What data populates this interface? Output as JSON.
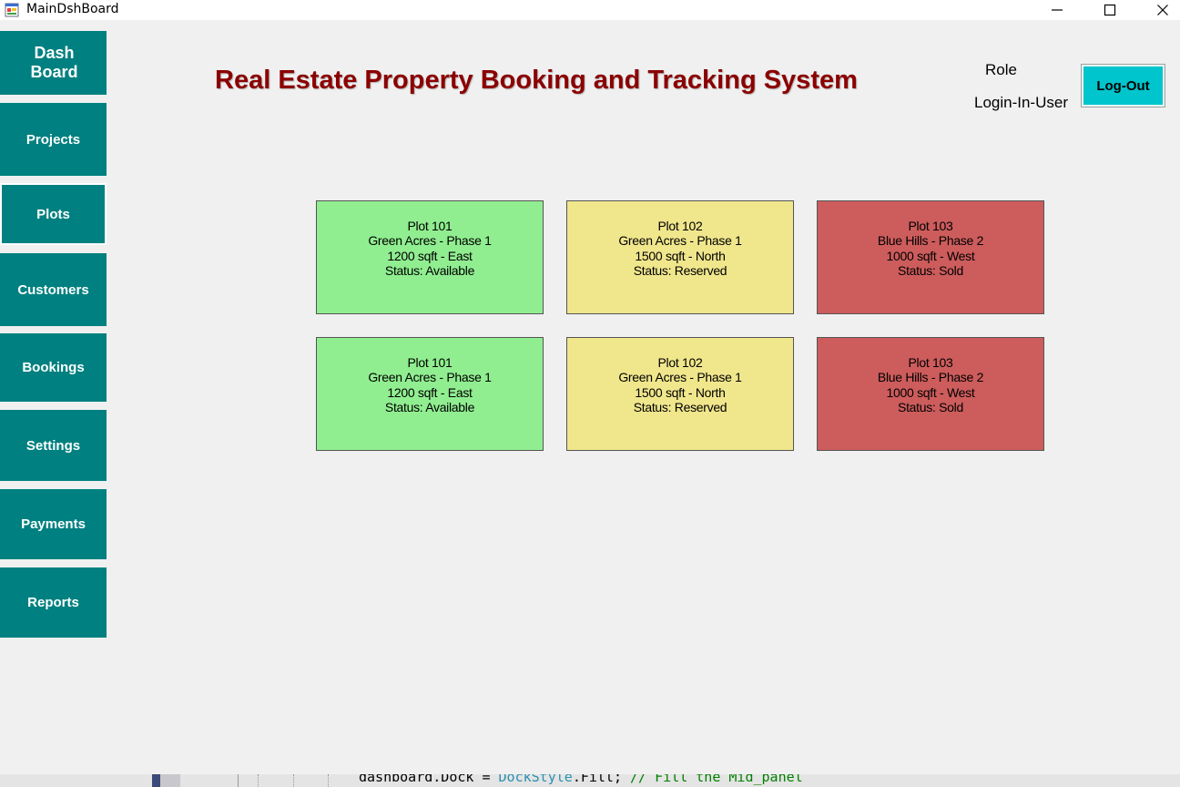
{
  "window": {
    "title": "MainDshBoard",
    "minimize_glyph": "—",
    "maximize_glyph": "☐",
    "close_glyph": "✕"
  },
  "sidebar": {
    "items": [
      {
        "label": "Dash\nBoard"
      },
      {
        "label": "Projects"
      },
      {
        "label": "Plots"
      },
      {
        "label": "Customers"
      },
      {
        "label": "Bookings"
      },
      {
        "label": "Settings"
      },
      {
        "label": "Payments"
      },
      {
        "label": "Reports"
      }
    ],
    "color": "#008080"
  },
  "header": {
    "title": "Real Estate Property Booking and Tracking System",
    "title_color": "#8b0000",
    "role_label": "Role",
    "user_label": "Login-In-User",
    "logout_label": "Log-Out",
    "logout_color": "#00c5cd"
  },
  "plots": [
    {
      "name": "Plot 101",
      "project": "Green Acres - Phase 1",
      "size": "1200 sqft - East",
      "status": "Status: Available",
      "color": "#90ee90"
    },
    {
      "name": "Plot 102",
      "project": "Green Acres - Phase 1",
      "size": "1500 sqft - North",
      "status": "Status: Reserved",
      "color": "#f0e68c"
    },
    {
      "name": "Plot 103",
      "project": "Blue Hills - Phase 2",
      "size": "1000 sqft - West",
      "status": "Status: Sold",
      "color": "#cd5c5c"
    },
    {
      "name": "Plot 101",
      "project": "Green Acres - Phase 1",
      "size": "1200 sqft - East",
      "status": "Status: Available",
      "color": "#90ee90"
    },
    {
      "name": "Plot 102",
      "project": "Green Acres - Phase 1",
      "size": "1500 sqft - North",
      "status": "Status: Reserved",
      "color": "#f0e68c"
    },
    {
      "name": "Plot 103",
      "project": "Blue Hills - Phase 2",
      "size": "1000 sqft - West",
      "status": "Status: Sold",
      "color": "#cd5c5c"
    }
  ],
  "background_code": {
    "part1": "dashboard.Dock = ",
    "part2": "DockStyle",
    "part3": ".Fill; ",
    "part4": "// Fill the Mid_panel"
  }
}
